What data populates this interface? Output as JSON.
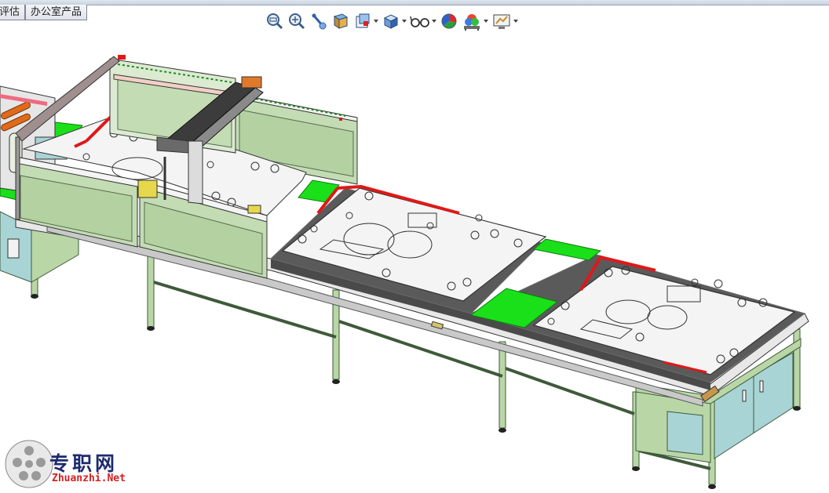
{
  "tabs": [
    {
      "label": "评估"
    },
    {
      "label": "办公室产品"
    }
  ],
  "toolbar": {
    "buttons": [
      {
        "icon": "zoom-to-fit-icon",
        "dropdown": false
      },
      {
        "icon": "zoom-to-area-icon",
        "dropdown": false
      },
      {
        "icon": "previous-view-icon",
        "dropdown": false
      },
      {
        "icon": "section-view-icon",
        "dropdown": false
      },
      {
        "icon": "view-orientation-icon",
        "dropdown": true
      },
      {
        "icon": "display-style-icon",
        "dropdown": true
      },
      {
        "icon": "hide-show-items-icon",
        "dropdown": true
      },
      {
        "icon": "edit-appearance-icon",
        "dropdown": false
      },
      {
        "icon": "apply-scene-icon",
        "dropdown": true
      },
      {
        "icon": "view-settings-icon",
        "dropdown": true
      }
    ]
  },
  "colors": {
    "frame": "#b9d7a6",
    "panel": "#c3dcb4",
    "plate": "#f4f4f4",
    "accent_red": "#e01818",
    "accent_green": "#19e019",
    "cabinet": "#a9d4d6",
    "rail": "#404040"
  },
  "watermark": {
    "title": "专职网",
    "url": "Zhuanzhi.Net"
  }
}
